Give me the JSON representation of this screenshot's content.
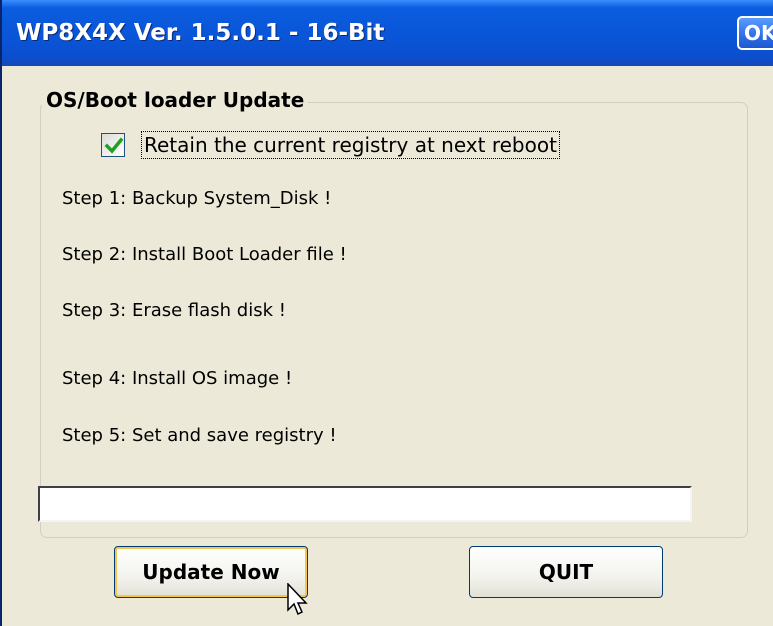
{
  "window": {
    "title": "WP8X4X Ver. 1.5.0.1 - 16-Bit",
    "ok_label": "OK"
  },
  "group": {
    "title": "OS/Boot loader Update",
    "checkbox": {
      "label": "Retain the current registry at next reboot",
      "checked": true
    },
    "steps": [
      "Step 1: Backup System_Disk !",
      "Step 2: Install Boot Loader file !",
      "Step 3: Erase flash disk !",
      "Step 4: Install OS image !",
      "Step 5: Set and save registry !"
    ],
    "progress": 0
  },
  "buttons": {
    "update_label": "Update Now",
    "quit_label": "QUIT"
  },
  "icons": {
    "checkmark": "checkmark-icon",
    "cursor": "mouse-cursor-icon"
  },
  "colors": {
    "titlebar": "#0a55d8",
    "window_bg": "#ece9d8",
    "check_green": "#21a121"
  }
}
